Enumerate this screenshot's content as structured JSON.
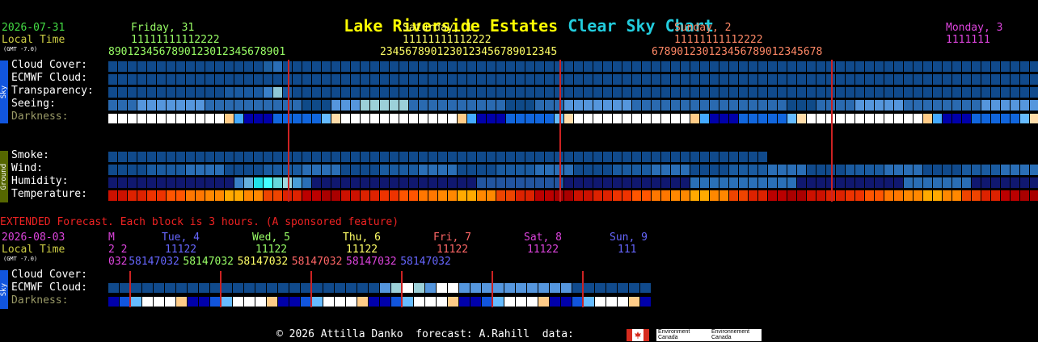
{
  "title": {
    "location": "Lake Riverside Estates",
    "chart_name": "Clear Sky Chart"
  },
  "main": {
    "date": "2026-07-31",
    "local_time_label": "Local Time",
    "gmt_label": "(GMT -7.0)",
    "days": [
      {
        "label": "Friday, 31",
        "color": "#99ff66"
      },
      {
        "label": "Saturday, 1",
        "color": "#ffff66"
      },
      {
        "label": "Sunday, 2",
        "color": "#ff8866"
      },
      {
        "label": "Monday, 3",
        "color": "#dd44dd"
      }
    ],
    "hour_tens_row": "11111111112222  11111111112222  11111111112222  1111111",
    "hour_ones_row": "89012345678901230123456789012345678901230123456789012345678901230123456789012345678",
    "sky_side_label": "Sky",
    "ground_side_label": "Ground",
    "sky_rows": [
      {
        "label": "Cloud Cover:",
        "color": "#ffffff"
      },
      {
        "label": "ECMWF Cloud:",
        "color": "#ffffff"
      },
      {
        "label": "Transparency:",
        "color": "#ffffff"
      },
      {
        "label": "Seeing:",
        "color": "#ffffff"
      },
      {
        "label": "Darkness:",
        "color": "#999966"
      }
    ],
    "ground_rows": [
      {
        "label": "Smoke:"
      },
      {
        "label": "Wind:"
      },
      {
        "label": "Humidity:"
      },
      {
        "label": "Temperature:"
      }
    ]
  },
  "extended": {
    "notice": "EXTENDED Forecast. Each block is 3 hours. (A sponsored feature)",
    "date": "2026-08-03",
    "local_time_label": "Local Time",
    "gmt_label": "(GMT -7.0)",
    "days": [
      {
        "label": "M",
        "color": "#dd44dd"
      },
      {
        "label": "Tue, 4",
        "color": "#6666ff"
      },
      {
        "label": "Wed, 5",
        "color": "#99ff66"
      },
      {
        "label": "Thu, 6",
        "color": "#ffff66"
      },
      {
        "label": "Fri, 7",
        "color": "#ff6666"
      },
      {
        "label": "Sat, 8",
        "color": "#dd44dd"
      },
      {
        "label": "Sun, 9",
        "color": "#6666ff"
      }
    ],
    "hour_tens_row": "22      11122      11122      11122      11122      11122      111",
    "hour_ones_row": "032581470325814703258147032581470325814703258147032581470325814",
    "sky_side_label": "Sky",
    "rows": [
      {
        "label": "Cloud Cover:",
        "color": "#ffffff"
      },
      {
        "label": "ECMWF Cloud:",
        "color": "#ffffff"
      },
      {
        "label": "Darkness:",
        "color": "#999966"
      }
    ]
  },
  "footer": {
    "text": "© 2026 Attilla Danko  forecast: A.Rahill  data:",
    "env1": "Environment Canada",
    "env2": "Environnement Canada"
  }
}
